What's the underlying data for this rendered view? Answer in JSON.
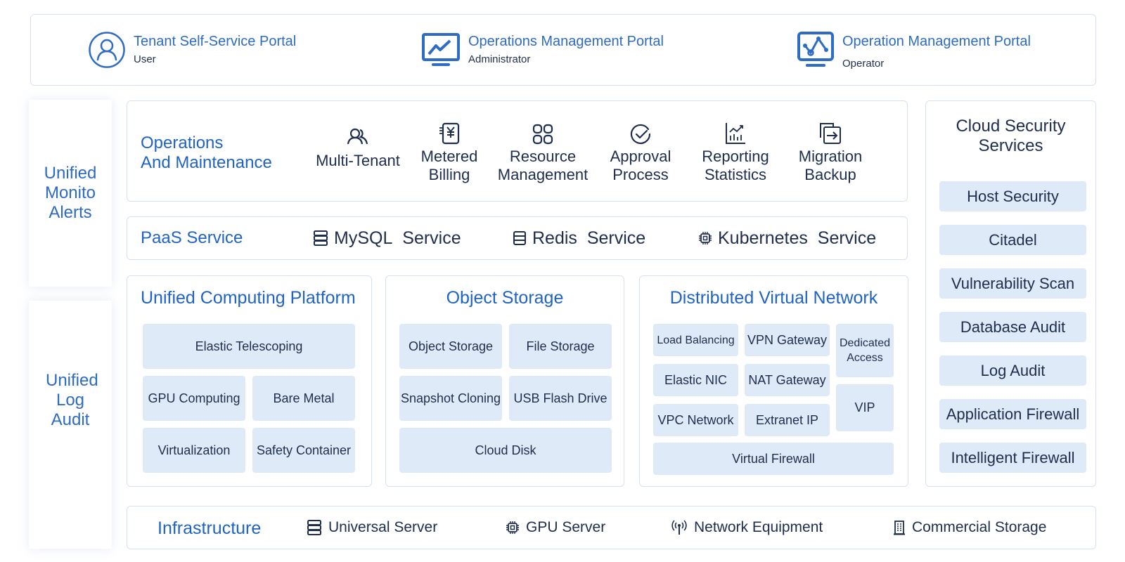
{
  "portals": [
    {
      "title": "Tenant Self-Service Portal",
      "role": "User",
      "icon": "user-icon"
    },
    {
      "title": "Operations Management Portal",
      "role": "Administrator",
      "icon": "monitor-chart-icon"
    },
    {
      "title": "Operation Management Portal",
      "role": "Operator",
      "icon": "monitor-network-icon"
    }
  ],
  "side": {
    "monitor": "Unified Monito Alerts",
    "log": "Unified Log Audit"
  },
  "ops": {
    "title_line1": "Operations",
    "title_line2": "And Maintenance",
    "items": [
      {
        "line1": "Multi-Tenant",
        "line2": "",
        "icon": "users-icon"
      },
      {
        "line1": "Metered",
        "line2": "Billing",
        "icon": "billing-yen-icon"
      },
      {
        "line1": "Resource",
        "line2": "Management",
        "icon": "grid-apps-icon"
      },
      {
        "line1": "Approval",
        "line2": "Process",
        "icon": "check-circle-icon"
      },
      {
        "line1": "Reporting",
        "line2": "Statistics",
        "icon": "bar-chart-icon"
      },
      {
        "line1": "Migration",
        "line2": "Backup",
        "icon": "migrate-icon"
      }
    ]
  },
  "paas": {
    "title": "PaaS Service",
    "items": [
      {
        "name": "MySQL",
        "suffix": "Service",
        "icon": "database-icon"
      },
      {
        "name": "Redis",
        "suffix": "Service",
        "icon": "database-icon"
      },
      {
        "name": "Kubernetes",
        "suffix": "Service",
        "icon": "chip-icon"
      }
    ]
  },
  "compute": {
    "title": "Unified Computing Platform",
    "tiles": [
      "Elastic Telescoping",
      "GPU Computing",
      "Bare Metal",
      "Virtualization",
      "Safety Container"
    ]
  },
  "object_storage": {
    "title": "Object Storage",
    "tiles": [
      "Object Storage",
      "File Storage",
      "Snapshot Cloning",
      "USB Flash Drive",
      "Cloud Disk"
    ]
  },
  "virtual_network": {
    "title": "Distributed Virtual Network",
    "tiles": [
      "Load Balancing",
      "VPN Gateway",
      "Dedicated Access",
      "Elastic NIC",
      "NAT Gateway",
      "VIP",
      "VPC Network",
      "Extranet IP",
      "Virtual Firewall"
    ]
  },
  "security": {
    "title_line1": "Cloud Security",
    "title_line2": "Services",
    "items": [
      "Host Security",
      "Citadel",
      "Vulnerability Scan",
      "Database Audit",
      "Log Audit",
      "Application Firewall",
      "Intelligent Firewall"
    ]
  },
  "infrastructure": {
    "title": "Infrastructure",
    "items": [
      {
        "label": "Universal Server",
        "icon": "server-icon"
      },
      {
        "label": "GPU Server",
        "icon": "chip-icon"
      },
      {
        "label": "Network Equipment",
        "icon": "antenna-icon"
      },
      {
        "label": "Commercial Storage",
        "icon": "building-storage-icon"
      }
    ]
  },
  "colors": {
    "accent": "#1f63c6",
    "tile_bg": "#dfeaf9",
    "border": "#d6e0f5",
    "text": "#1f2d4d"
  }
}
